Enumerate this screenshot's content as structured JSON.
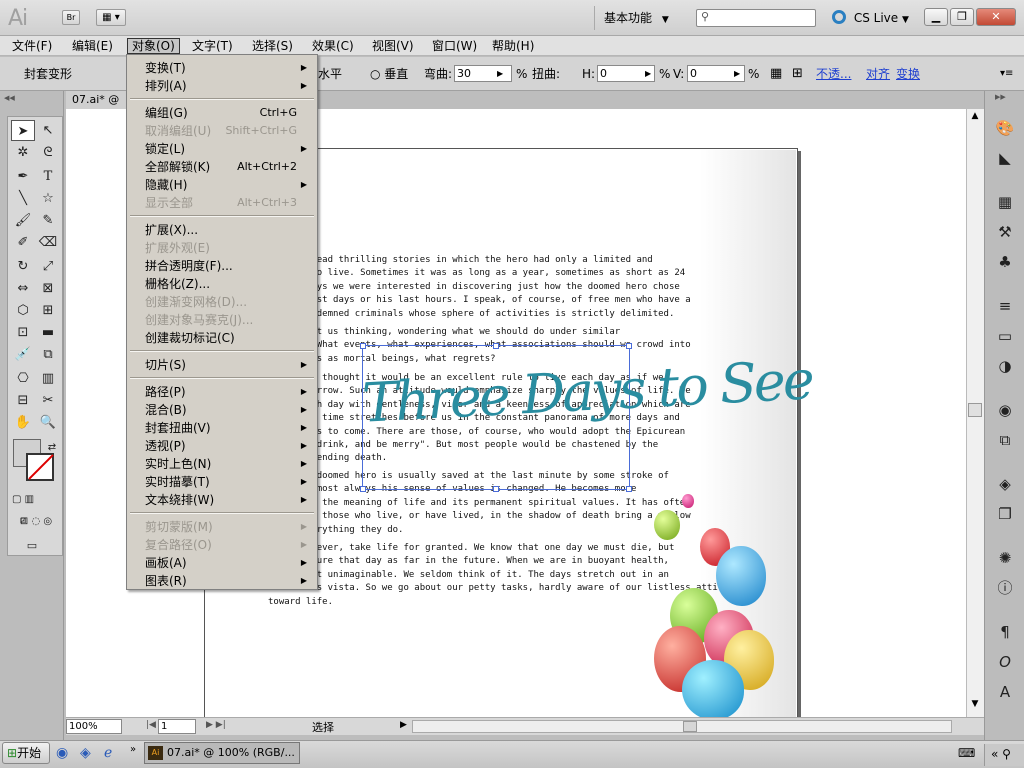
{
  "titlebar": {
    "app_logo": "Ai",
    "bridge_label": "Br",
    "workspace": "基本功能",
    "cslive": "CS Live"
  },
  "menubar": {
    "items": [
      "文件(F)",
      "编辑(E)",
      "对象(O)",
      "文字(T)",
      "选择(S)",
      "效果(C)",
      "视图(V)",
      "窗口(W)",
      "帮助(H)"
    ]
  },
  "controlbar": {
    "left_label": "封套变形",
    "horizontal": "水平",
    "vertical": "垂直",
    "bend_label": "弯曲:",
    "bend_value": "30",
    "percent": "%",
    "distort_label": "扭曲:",
    "h_label": "H:",
    "h_value": "0",
    "v_label": "V:",
    "v_value": "0",
    "opacity_link": "不透...",
    "align_link": "对齐",
    "transform_link": "变换"
  },
  "document": {
    "tab": "07.ai* @",
    "paragraphs": [
      "   have read thrilling stories in which the hero had only a limited and\n   time to live. Sometimes it was as long as a year, sometimes as short as 24\n   t always we were interested in discovering just how the doomed hero chose\n   his last days or his last hours. I speak, of course, of free men who have a\n   ot condemned criminals whose sphere of activities is strictly delimited.",
      "   ies set us thinking, wondering what we should do under similar\n   nces. What events, what experiences, what associations should we crowd into\n   t hours as mortal beings, what regrets?",
      "   I have thought it would be an excellent rule to live each day as if we\n   e tomorrow. Such an attitude would emphasize sharply the values of life. We\n   ve each day with gentleness, vigor and a keenness of appreciation which are\n   t when time stretches before us in the constant panorama of more days and\n   d years to come. There are those, of course, who would adopt the Epicurean\n   \"Eat, drink, and be merry\". But most people would be chastened by the\n   of impending death.",
      "   s the doomed hero is usually saved at the last minute by some stroke of\n   but almost always his sense of values is changed. He becomes more\n   ive of the meaning of life and its permanent spiritual values. It has often\n   d that those who live, or have lived, in the shadow of death bring a mellow\n   to everything they do.",
      "   s, however, take life for granted. We know that one day we must die, but\n   e picture that day as far in the future. When we are in buoyant health,\n   all but unimaginable. We seldom think of it. The days stretch out in an\n   endless vista. So we go about our petty tasks, hardly aware of our listless attitude\ntoward life."
    ],
    "art_title": "Three Days to See"
  },
  "dropdown": {
    "groups": [
      [
        {
          "label": "变换(T)",
          "shortcut": "",
          "submenu": true,
          "disabled": false
        },
        {
          "label": "排列(A)",
          "shortcut": "",
          "submenu": true,
          "disabled": false
        }
      ],
      [
        {
          "label": "编组(G)",
          "shortcut": "Ctrl+G",
          "submenu": false,
          "disabled": false
        },
        {
          "label": "取消编组(U)",
          "shortcut": "Shift+Ctrl+G",
          "submenu": false,
          "disabled": true
        },
        {
          "label": "锁定(L)",
          "shortcut": "",
          "submenu": true,
          "disabled": false
        },
        {
          "label": "全部解锁(K)",
          "shortcut": "Alt+Ctrl+2",
          "submenu": false,
          "disabled": false
        },
        {
          "label": "隐藏(H)",
          "shortcut": "",
          "submenu": true,
          "disabled": false
        },
        {
          "label": "显示全部",
          "shortcut": "Alt+Ctrl+3",
          "submenu": false,
          "disabled": true
        }
      ],
      [
        {
          "label": "扩展(X)...",
          "shortcut": "",
          "submenu": false,
          "disabled": false
        },
        {
          "label": "扩展外观(E)",
          "shortcut": "",
          "submenu": false,
          "disabled": true
        },
        {
          "label": "拼合透明度(F)...",
          "shortcut": "",
          "submenu": false,
          "disabled": false
        },
        {
          "label": "栅格化(Z)...",
          "shortcut": "",
          "submenu": false,
          "disabled": false
        },
        {
          "label": "创建渐变网格(D)...",
          "shortcut": "",
          "submenu": false,
          "disabled": true
        },
        {
          "label": "创建对象马赛克(J)...",
          "shortcut": "",
          "submenu": false,
          "disabled": true
        },
        {
          "label": "创建裁切标记(C)",
          "shortcut": "",
          "submenu": false,
          "disabled": false
        }
      ],
      [
        {
          "label": "切片(S)",
          "shortcut": "",
          "submenu": true,
          "disabled": false
        }
      ],
      [
        {
          "label": "路径(P)",
          "shortcut": "",
          "submenu": true,
          "disabled": false
        },
        {
          "label": "混合(B)",
          "shortcut": "",
          "submenu": true,
          "disabled": false
        },
        {
          "label": "封套扭曲(V)",
          "shortcut": "",
          "submenu": true,
          "disabled": false
        },
        {
          "label": "透视(P)",
          "shortcut": "",
          "submenu": true,
          "disabled": false
        },
        {
          "label": "实时上色(N)",
          "shortcut": "",
          "submenu": true,
          "disabled": false
        },
        {
          "label": "实时描摹(T)",
          "shortcut": "",
          "submenu": true,
          "disabled": false
        },
        {
          "label": "文本绕排(W)",
          "shortcut": "",
          "submenu": true,
          "disabled": false
        }
      ],
      [
        {
          "label": "剪切蒙版(M)",
          "shortcut": "",
          "submenu": true,
          "disabled": true
        },
        {
          "label": "复合路径(O)",
          "shortcut": "",
          "submenu": true,
          "disabled": true
        },
        {
          "label": "画板(A)",
          "shortcut": "",
          "submenu": true,
          "disabled": false
        },
        {
          "label": "图表(R)",
          "shortcut": "",
          "submenu": true,
          "disabled": false
        }
      ]
    ]
  },
  "statusbar": {
    "zoom": "100%",
    "page": "1",
    "tool": "选择"
  },
  "taskbar": {
    "start": "开始",
    "task_item": "07.ai* @ 100% (RGB/..."
  },
  "colors": {
    "title_text": "#2a8da0",
    "selection": "#4a6cd8",
    "menu_bg": "#d4d0c8"
  }
}
